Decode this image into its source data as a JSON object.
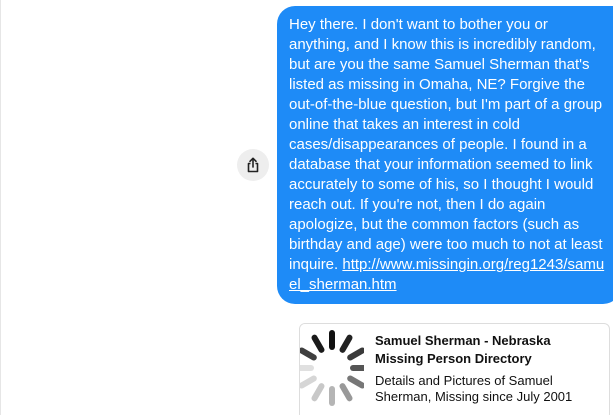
{
  "colors": {
    "bubble": "#1e8bf7",
    "bubble_text": "#ffffff",
    "share_button_bg": "#eeeeee"
  },
  "message": {
    "text": "Hey there. I don't want to bother you or anything, and I know this is incredibly random, but are you the same Samuel Sherman that's listed as missing in Omaha, NE? Forgive the out-of-the-blue question, but I'm part of a group online that takes an interest in cold cases/disappearances of people. I found in a database that your information seemed to link accurately to some of his, so I thought I would reach out. If you're not, then I do again apologize, but the common factors (such as birthday and age) were too much to not at least inquire.",
    "link": "http://www.missingin.org/reg1243/samuel_sherman.htm"
  },
  "share_button": {
    "icon": "share-icon"
  },
  "link_preview": {
    "thumbnail_icon": "spinner-thumbnail",
    "title": "Samuel Sherman - Nebraska Missing Person Directory",
    "description": "Details and Pictures of Samuel Sherman, Missing since July 2001"
  }
}
